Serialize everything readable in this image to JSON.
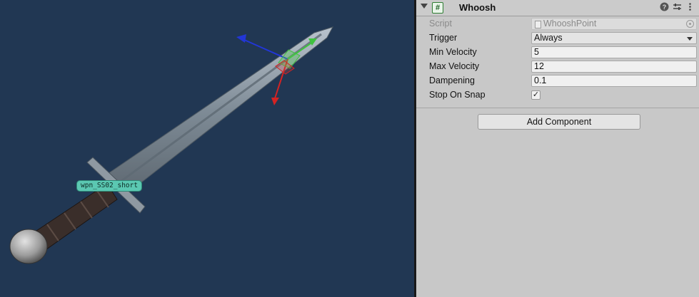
{
  "scene": {
    "object_label": "wpn_SS02_short",
    "colors": {
      "background": "#213753",
      "label": "#5bc8b2"
    }
  },
  "inspector": {
    "component": {
      "title": "Whoosh",
      "icon": "hash-icon",
      "buttons": [
        "help-icon",
        "preset-icon",
        "kebab-icon"
      ]
    },
    "fields": {
      "script": {
        "label": "Script",
        "value": "WhooshPoint"
      },
      "trigger": {
        "label": "Trigger",
        "value": "Always"
      },
      "min_velocity": {
        "label": "Min Velocity",
        "value": "5"
      },
      "max_velocity": {
        "label": "Max Velocity",
        "value": "12"
      },
      "dampening": {
        "label": "Dampening",
        "value": "0.1"
      },
      "stop_on_snap": {
        "label": "Stop On Snap",
        "checked": true
      }
    },
    "add_component_label": "Add Component"
  }
}
